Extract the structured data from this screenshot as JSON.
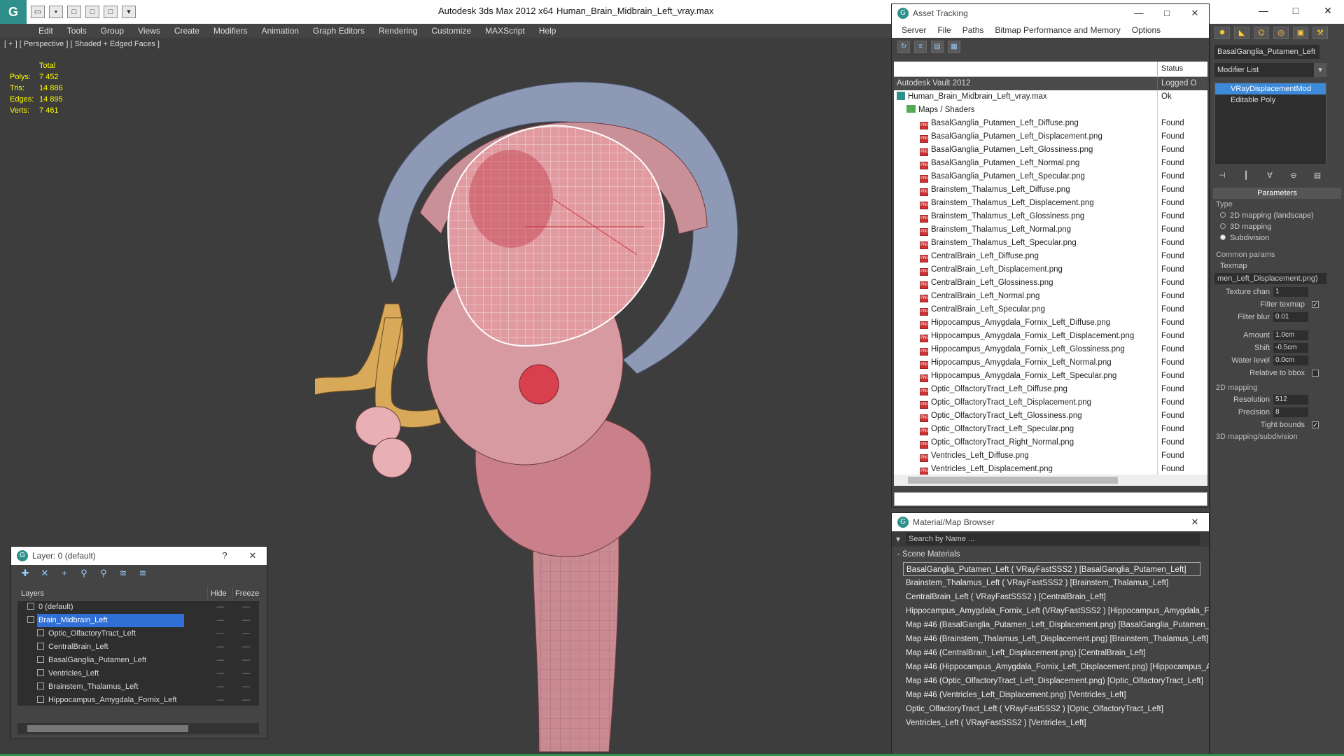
{
  "titlebar": {
    "app_title": "Autodesk 3ds Max  2012 x64",
    "file_title": "Human_Brain_Midbrain_Left_vray.max",
    "logo_glyph": "G",
    "controls": [
      "—",
      "□",
      "✕"
    ]
  },
  "menu": [
    "Edit",
    "Tools",
    "Group",
    "Views",
    "Create",
    "Modifiers",
    "Animation",
    "Graph Editors",
    "Rendering",
    "Customize",
    "MAXScript",
    "Help"
  ],
  "viewport": {
    "label": "[ + ] [ Perspective ] [ Shaded + Edged Faces ]",
    "stats_header": "Total",
    "stats": [
      {
        "key": "Polys:",
        "value": "7 452"
      },
      {
        "key": "Tris:",
        "value": "14 886"
      },
      {
        "key": "Edges:",
        "value": "14 895"
      },
      {
        "key": "Verts:",
        "value": "7 461"
      }
    ]
  },
  "asset_tracking": {
    "title": "Asset Tracking",
    "menu": [
      "Server",
      "File",
      "Paths",
      "Bitmap Performance and Memory",
      "Options"
    ],
    "status_header": "Status",
    "vault": {
      "name": "Autodesk Vault 2012",
      "status": "Logged O"
    },
    "file": {
      "name": "Human_Brain_Midbrain_Left_vray.max",
      "status": "Ok"
    },
    "folder": {
      "name": "Maps / Shaders",
      "status": ""
    },
    "maps": [
      {
        "name": "BasalGanglia_Putamen_Left_Diffuse.png",
        "status": "Found"
      },
      {
        "name": "BasalGanglia_Putamen_Left_Displacement.png",
        "status": "Found"
      },
      {
        "name": "BasalGanglia_Putamen_Left_Glossiness.png",
        "status": "Found"
      },
      {
        "name": "BasalGanglia_Putamen_Left_Normal.png",
        "status": "Found"
      },
      {
        "name": "BasalGanglia_Putamen_Left_Specular.png",
        "status": "Found"
      },
      {
        "name": "Brainstem_Thalamus_Left_Diffuse.png",
        "status": "Found"
      },
      {
        "name": "Brainstem_Thalamus_Left_Displacement.png",
        "status": "Found"
      },
      {
        "name": "Brainstem_Thalamus_Left_Glossiness.png",
        "status": "Found"
      },
      {
        "name": "Brainstem_Thalamus_Left_Normal.png",
        "status": "Found"
      },
      {
        "name": "Brainstem_Thalamus_Left_Specular.png",
        "status": "Found"
      },
      {
        "name": "CentralBrain_Left_Diffuse.png",
        "status": "Found"
      },
      {
        "name": "CentralBrain_Left_Displacement.png",
        "status": "Found"
      },
      {
        "name": "CentralBrain_Left_Glossiness.png",
        "status": "Found"
      },
      {
        "name": "CentralBrain_Left_Normal.png",
        "status": "Found"
      },
      {
        "name": "CentralBrain_Left_Specular.png",
        "status": "Found"
      },
      {
        "name": "Hippocampus_Amygdala_Fornix_Left_Diffuse.png",
        "status": "Found"
      },
      {
        "name": "Hippocampus_Amygdala_Fornix_Left_Displacement.png",
        "status": "Found"
      },
      {
        "name": "Hippocampus_Amygdala_Fornix_Left_Glossiness.png",
        "status": "Found"
      },
      {
        "name": "Hippocampus_Amygdala_Fornix_Left_Normal.png",
        "status": "Found"
      },
      {
        "name": "Hippocampus_Amygdala_Fornix_Left_Specular.png",
        "status": "Found"
      },
      {
        "name": "Optic_OlfactoryTract_Left_Diffuse.png",
        "status": "Found"
      },
      {
        "name": "Optic_OlfactoryTract_Left_Displacement.png",
        "status": "Found"
      },
      {
        "name": "Optic_OlfactoryTract_Left_Glossiness.png",
        "status": "Found"
      },
      {
        "name": "Optic_OlfactoryTract_Left_Specular.png",
        "status": "Found"
      },
      {
        "name": "Optic_OlfactoryTract_Right_Normal.png",
        "status": "Found"
      },
      {
        "name": "Ventricles_Left_Diffuse.png",
        "status": "Found"
      },
      {
        "name": "Ventricles_Left_Displacement.png",
        "status": "Found"
      }
    ]
  },
  "material_browser": {
    "title": "Material/Map Browser",
    "search_placeholder": "Search by Name ...",
    "section": "- Scene Materials",
    "items": [
      "BasalGanglia_Putamen_Left  ( VRayFastSSS2 )  [BasalGanglia_Putamen_Left]",
      "Brainstem_Thalamus_Left  ( VRayFastSSS2 )  [Brainstem_Thalamus_Left]",
      "CentralBrain_Left  ( VRayFastSSS2 )  [CentralBrain_Left]",
      "Hippocampus_Amygdala_Fornix_Left  (VRayFastSSS2 ) [Hippocampus_Amygdala_Fornix_Left]",
      "Map #46 (BasalGanglia_Putamen_Left_Displacement.png) [BasalGanglia_Putamen_Left]",
      "Map #46 (Brainstem_Thalamus_Left_Displacement.png)  [Brainstem_Thalamus_Left]",
      "Map #46 (CentralBrain_Left_Displacement.png) [CentralBrain_Left]",
      "Map #46 (Hippocampus_Amygdala_Fornix_Left_Displacement.png) [Hippocampus_Amygdala_Fornix_Left]",
      "Map #46 (Optic_OlfactoryTract_Left_Displacement.png) [Optic_OlfactoryTract_Left]",
      "Map #46 (Ventricles_Left_Displacement.png) [Ventricles_Left]",
      "Optic_OlfactoryTract_Left  ( VRayFastSSS2 )  [Optic_OlfactoryTract_Left]",
      "Ventricles_Left  ( VRayFastSSS2 )  [Ventricles_Left]"
    ]
  },
  "command_panel": {
    "object_name": "BasalGanglia_Putamen_Left",
    "modifier_list": "Modifier List",
    "stack": [
      "VRayDisplacementMod",
      "Editable Poly"
    ],
    "params_title": "Parameters",
    "type_label": "Type",
    "type_options": [
      {
        "label": "2D mapping (landscape)",
        "selected": false
      },
      {
        "label": "3D mapping",
        "selected": false
      },
      {
        "label": "Subdivision",
        "selected": true
      }
    ],
    "common_params": "Common params",
    "texmap_label": "Texmap",
    "texmap_value": "men_Left_Displacement.png)",
    "texture_chan": {
      "label": "Texture chan",
      "value": "1"
    },
    "filter_texmap": {
      "label": "Filter texmap",
      "checked": true
    },
    "filter_blur": {
      "label": "Filter blur",
      "value": "0.01"
    },
    "amount": {
      "label": "Amount",
      "value": "1.0cm"
    },
    "shift": {
      "label": "Shift",
      "value": "-0.5cm"
    },
    "water_level": {
      "label": "Water level",
      "value": "0.0cm"
    },
    "relative_bbox": {
      "label": "Relative to bbox",
      "checked": false
    },
    "mapping_2d": "2D mapping",
    "resolution": {
      "label": "Resolution",
      "value": "512"
    },
    "precision": {
      "label": "Precision",
      "value": "8"
    },
    "tight_bounds": {
      "label": "Tight bounds",
      "checked": true
    },
    "mapping_sub": "3D mapping/subdivision"
  },
  "layer_dialog": {
    "title": "Layer: 0 (default)",
    "help": "?",
    "close": "✕",
    "head_layers": "Layers",
    "head_hide": "Hide",
    "head_freeze": "Freeze",
    "rows": [
      {
        "name": "0 (default)",
        "indent": 1,
        "selected": false
      },
      {
        "name": "Brain_Midbrain_Left",
        "indent": 1,
        "selected": true
      },
      {
        "name": "Optic_OlfactoryTract_Left",
        "indent": 2,
        "selected": false
      },
      {
        "name": "CentralBrain_Left",
        "indent": 2,
        "selected": false
      },
      {
        "name": "BasalGanglia_Putamen_Left",
        "indent": 2,
        "selected": false
      },
      {
        "name": "Ventricles_Left",
        "indent": 2,
        "selected": false
      },
      {
        "name": "Brainstem_Thalamus_Left",
        "indent": 2,
        "selected": false
      },
      {
        "name": "Hippocampus_Amygdala_Fornix_Left",
        "indent": 2,
        "selected": false
      }
    ]
  }
}
